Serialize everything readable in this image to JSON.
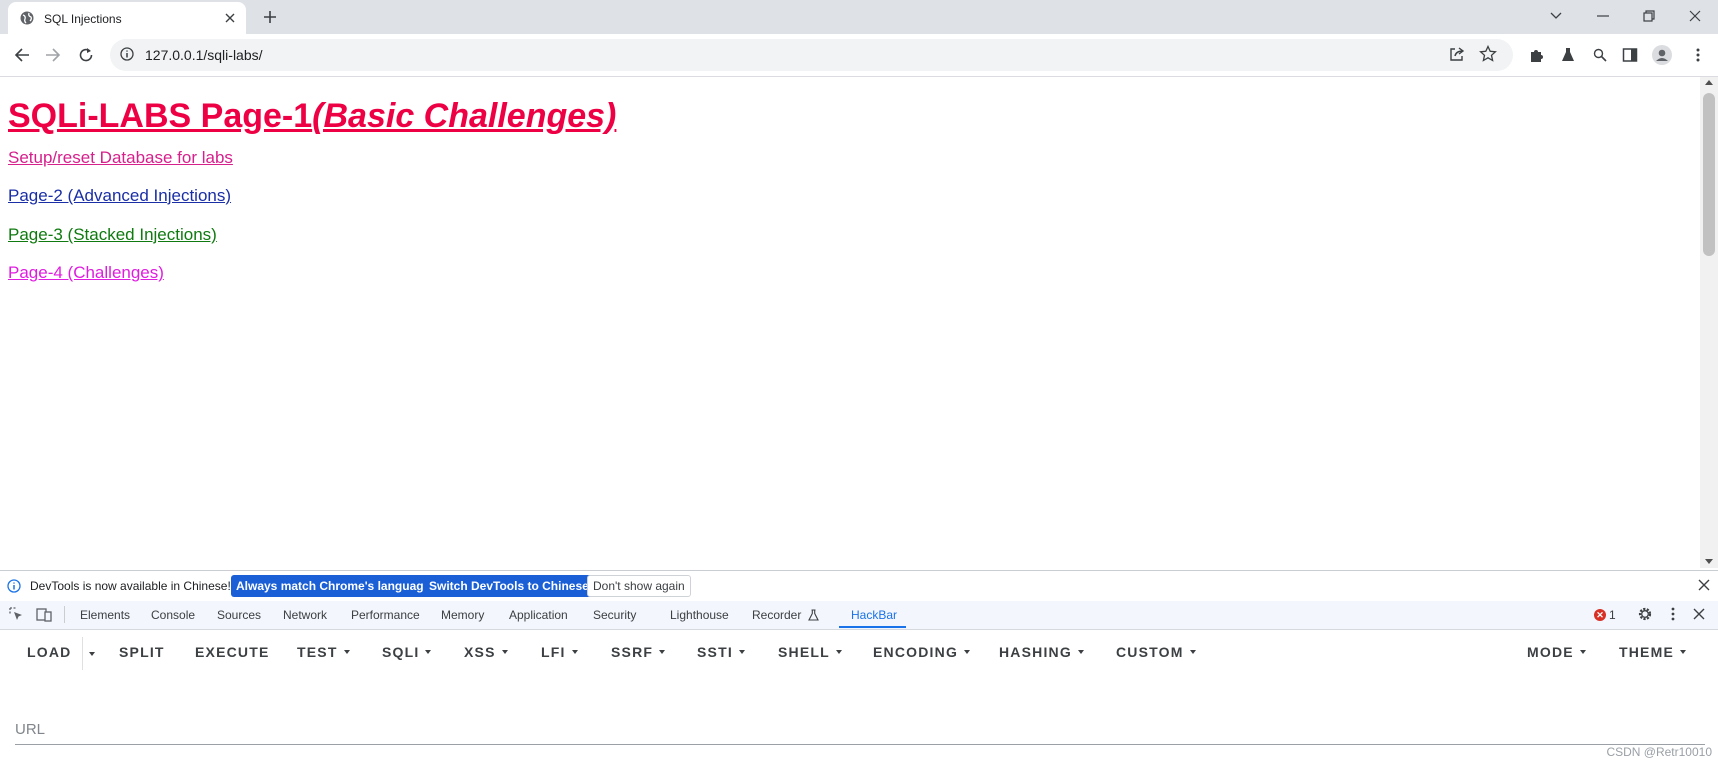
{
  "browser": {
    "tab": {
      "title": "SQL Injections"
    },
    "url": "127.0.0.1/sqli-labs/"
  },
  "page": {
    "heading_main": "SQLi-LABS Page-1",
    "heading_sub": "(Basic Challenges)",
    "links": [
      {
        "label": "Setup/reset Database for labs",
        "color": "#d6208c"
      },
      {
        "label": "Page-2 (Advanced Injections)",
        "color": "#1a2ea6"
      },
      {
        "label": "Page-3 (Stacked Injections)",
        "color": "#0f7a0f"
      },
      {
        "label": "Page-4 (Challenges)",
        "color": "#e01ce0"
      }
    ]
  },
  "devtools": {
    "infobar": {
      "message": "DevTools is now available in Chinese!",
      "btn_match": "Always match Chrome's language",
      "btn_switch": "Switch DevTools to Chinese",
      "btn_dont_show": "Don't show again"
    },
    "tabs": [
      "Elements",
      "Console",
      "Sources",
      "Network",
      "Performance",
      "Memory",
      "Application",
      "Security",
      "Lighthouse",
      "Recorder",
      "HackBar"
    ],
    "active_tab": "HackBar",
    "error_count": "1"
  },
  "hackbar": {
    "menu": {
      "load": "LOAD",
      "split": "SPLIT",
      "execute": "EXECUTE",
      "test": "TEST",
      "sqli": "SQLI",
      "xss": "XSS",
      "lfi": "LFI",
      "ssrf": "SSRF",
      "ssti": "SSTI",
      "shell": "SHELL",
      "encoding": "ENCODING",
      "hashing": "HASHING",
      "custom": "CUSTOM",
      "mode": "MODE",
      "theme": "THEME"
    },
    "url_placeholder": "URL"
  },
  "watermark": "CSDN @Retr10010"
}
